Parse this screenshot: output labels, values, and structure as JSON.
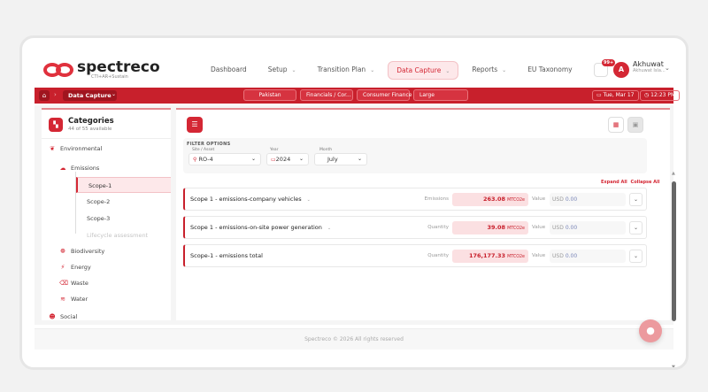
{
  "brand": {
    "name": "spectreco",
    "tagline": "CTI+AR+Sustain",
    "accent": "#d42734"
  },
  "nav": [
    {
      "label": "Dashboard",
      "chevron": false,
      "active": false
    },
    {
      "label": "Setup",
      "chevron": true,
      "active": false
    },
    {
      "label": "Transition Plan",
      "chevron": true,
      "active": false
    },
    {
      "label": "Data Capture",
      "chevron": true,
      "active": true
    },
    {
      "label": "Reports",
      "chevron": true,
      "active": false
    },
    {
      "label": "EU Taxonomy",
      "chevron": false,
      "active": false
    }
  ],
  "notifications": {
    "badge": "99+",
    "icon": "bell-icon"
  },
  "user": {
    "initial": "A",
    "name": "Akhuwat",
    "email": "Akhuwat Isla..."
  },
  "breadcrumb": {
    "current": "Data Capture"
  },
  "context_chips": [
    "Pakistan",
    "Financials / Cor...",
    "Consumer Finance",
    "Large"
  ],
  "datetime": {
    "date": "Tue, Mar 17",
    "time": "12:23 PM"
  },
  "sidebar": {
    "title": "Categories",
    "subtitle": "44 of 55 available",
    "group": "Environmental",
    "items": [
      {
        "label": "Emissions",
        "icon": "cloud-icon"
      },
      {
        "label": "Biodiversity",
        "icon": "leaf-icon"
      },
      {
        "label": "Energy",
        "icon": "energy-icon"
      },
      {
        "label": "Waste",
        "icon": "trash-icon"
      },
      {
        "label": "Water",
        "icon": "water-icon"
      }
    ],
    "scopes": [
      {
        "label": "Scope-1",
        "state": "active"
      },
      {
        "label": "Scope-2",
        "state": "normal"
      },
      {
        "label": "Scope-3",
        "state": "normal"
      },
      {
        "label": "Lifecycle assessment",
        "state": "muted"
      }
    ],
    "next_group": "Social"
  },
  "filters": {
    "title": "FILTER OPTIONS",
    "site_label": "Site / Asset",
    "site_value": "RO-4",
    "year_label": "Year",
    "year_value": "2024",
    "month_label": "Month",
    "month_value": "July"
  },
  "actions": {
    "expand_all": "Expand All",
    "collapse_all": "Collapse All"
  },
  "rows": [
    {
      "title": "Scope 1 - emissions-company vehicles",
      "chevron": true,
      "label": "Emissions",
      "value": "263.08",
      "unit": "MTCO2e",
      "value_label": "Value",
      "currency": "USD",
      "amount": "0.00"
    },
    {
      "title": "Scope 1 - emissions-on-site power generation",
      "chevron": true,
      "label": "Quantity",
      "value": "39.08",
      "unit": "MTCO2e",
      "value_label": "Value",
      "currency": "USD",
      "amount": "0.00"
    },
    {
      "title": "Scope-1 - emissions total",
      "chevron": false,
      "label": "Quantity",
      "value": "176,177.33",
      "unit": "MTCO2e",
      "value_label": "Value",
      "currency": "USD",
      "amount": "0.00"
    }
  ],
  "footer": "Spectreco © 2026 All rights reserved"
}
